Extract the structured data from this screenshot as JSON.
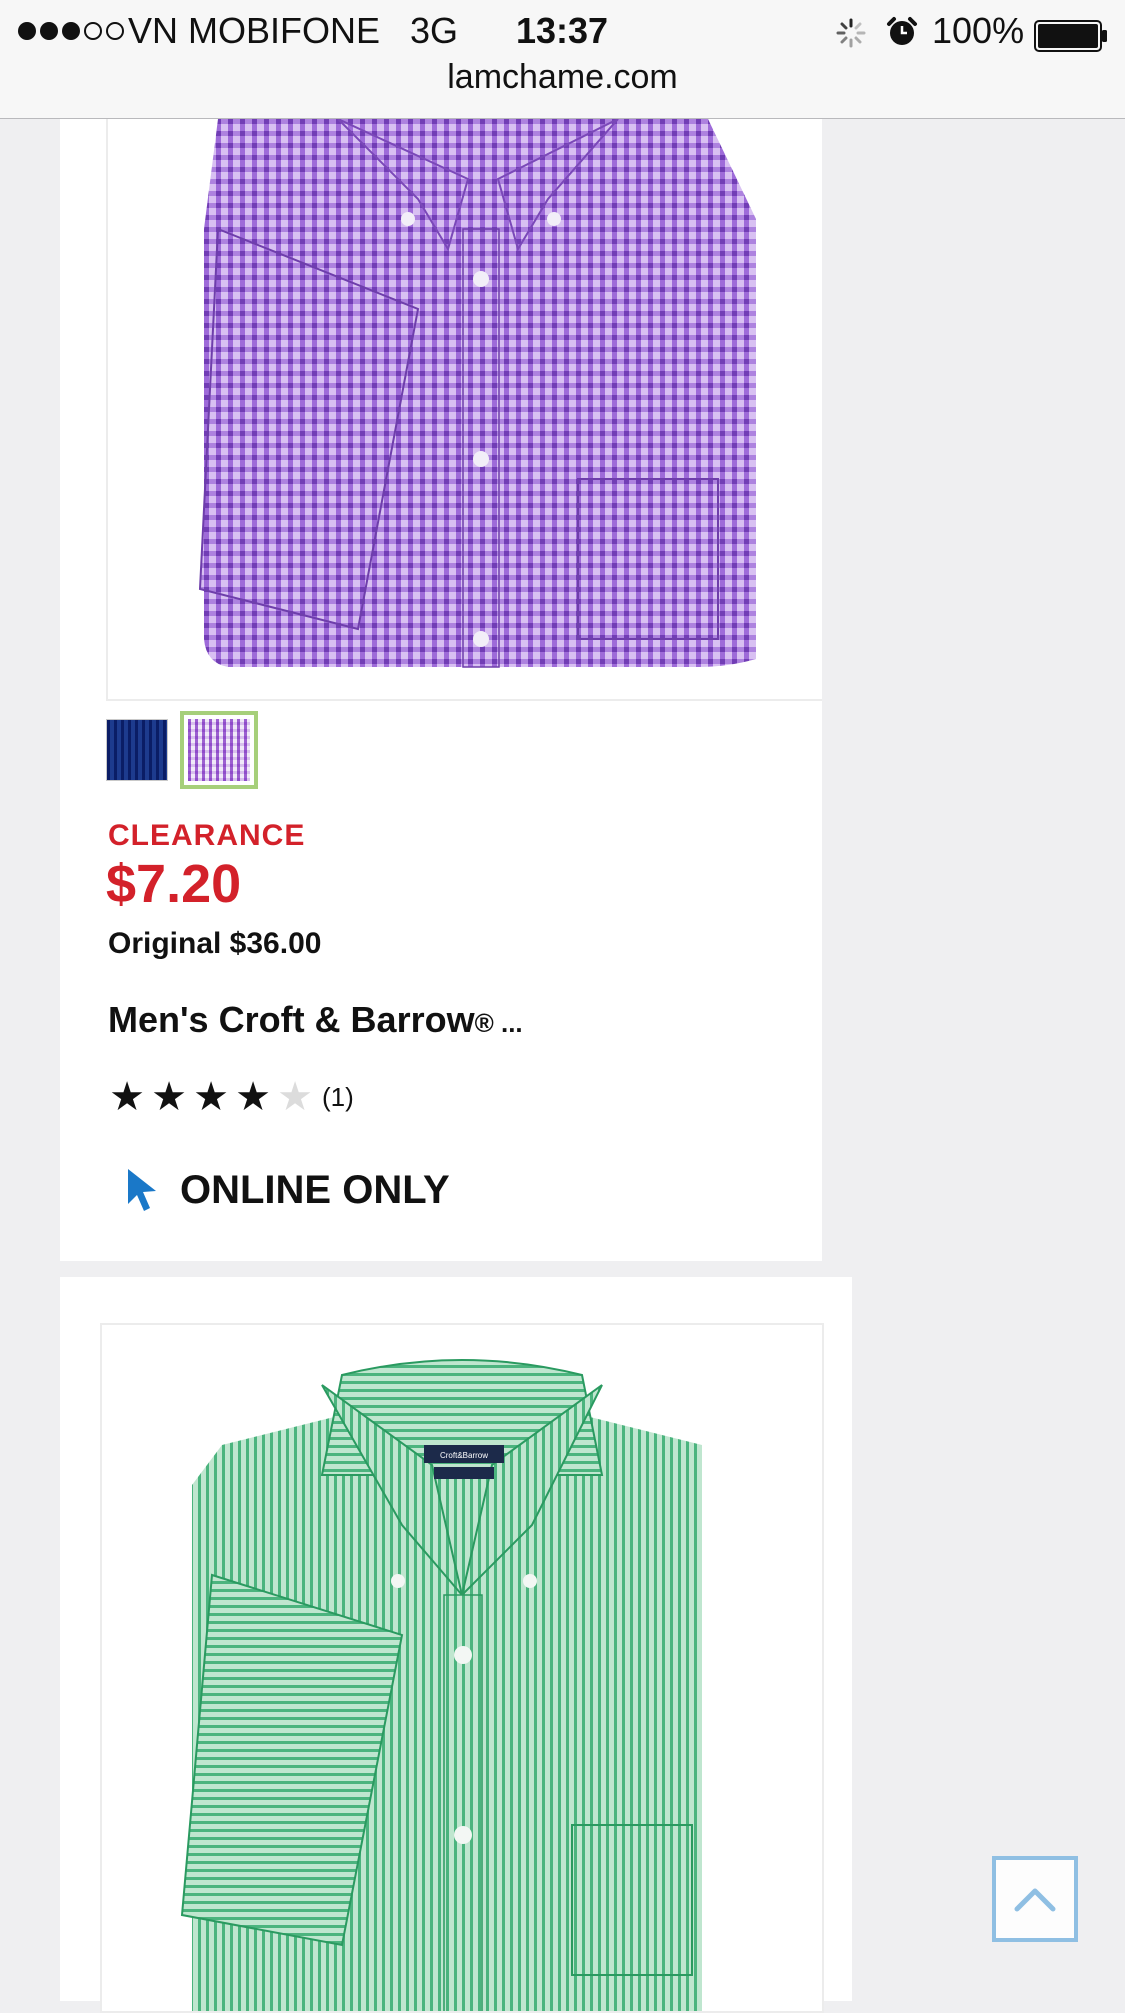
{
  "status_bar": {
    "carrier": "VN MOBIFONE",
    "network": "3G",
    "time": "13:37",
    "battery": "100%",
    "signal_bars_filled": 3,
    "signal_bars_total": 5
  },
  "browser": {
    "url": "lamchame.com"
  },
  "products": [
    {
      "image_icon": "purple-gingham-shirt",
      "swatches": [
        {
          "name": "blue-plaid",
          "color": "#3a5ea8",
          "selected": false
        },
        {
          "name": "purple-gingham",
          "color": "#b48ae0",
          "selected": true
        }
      ],
      "badge": "CLEARANCE",
      "price": "$7.20",
      "original_price": "Original $36.00",
      "name": "Men's Croft & Barrow",
      "name_suffix": "® ...",
      "rating": {
        "stars_filled": 4,
        "stars_total": 5,
        "count": "(1)"
      },
      "availability": "ONLINE ONLY"
    },
    {
      "image_icon": "green-striped-shirt",
      "label_text": "Croft&Barrow"
    }
  ],
  "colors": {
    "price_red": "#d3212a",
    "selected_swatch_border": "#a6cf7a",
    "cursor_blue": "#1a78c8",
    "back_to_top_border": "#8fbfe3"
  },
  "back_to_top": {
    "icon": "chevron-up-icon"
  }
}
